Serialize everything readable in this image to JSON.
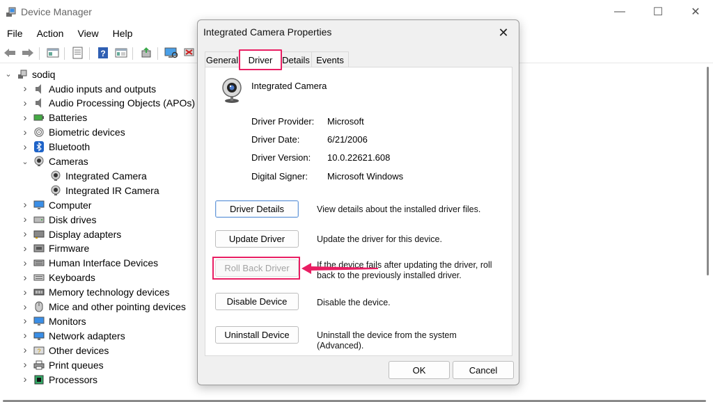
{
  "app": {
    "title": "Device Manager"
  },
  "window_controls": {
    "minimize": "—",
    "maximize": "☐",
    "close": "✕"
  },
  "menu": [
    "File",
    "Action",
    "View",
    "Help"
  ],
  "toolbar": {
    "icons": [
      "back-icon",
      "forward-icon",
      "properties-icon",
      "refresh-icon",
      "help-icon",
      "show-hidden-icon",
      "update-driver-icon",
      "scan-hardware-icon",
      "remove-device-icon"
    ]
  },
  "tree": {
    "root": "sodiq",
    "items": [
      {
        "label": "Audio inputs and outputs",
        "icon": "speaker-icon",
        "expanded": false
      },
      {
        "label": "Audio Processing Objects (APOs)",
        "icon": "speaker-icon",
        "expanded": false
      },
      {
        "label": "Batteries",
        "icon": "battery-icon",
        "expanded": false
      },
      {
        "label": "Biometric devices",
        "icon": "fingerprint-icon",
        "expanded": false
      },
      {
        "label": "Bluetooth",
        "icon": "bluetooth-icon",
        "expanded": false
      },
      {
        "label": "Cameras",
        "icon": "camera-icon",
        "expanded": true
      },
      {
        "label": "Integrated Camera",
        "icon": "camera-icon",
        "child": true
      },
      {
        "label": "Integrated IR Camera",
        "icon": "camera-icon",
        "child": true
      },
      {
        "label": "Computer",
        "icon": "monitor-icon",
        "expanded": false
      },
      {
        "label": "Disk drives",
        "icon": "disk-icon",
        "expanded": false
      },
      {
        "label": "Display adapters",
        "icon": "display-adapter-icon",
        "expanded": false
      },
      {
        "label": "Firmware",
        "icon": "firmware-icon",
        "expanded": false
      },
      {
        "label": "Human Interface Devices",
        "icon": "hid-icon",
        "expanded": false
      },
      {
        "label": "Keyboards",
        "icon": "keyboard-icon",
        "expanded": false
      },
      {
        "label": "Memory technology devices",
        "icon": "memory-icon",
        "expanded": false
      },
      {
        "label": "Mice and other pointing devices",
        "icon": "mouse-icon",
        "expanded": false
      },
      {
        "label": "Monitors",
        "icon": "monitor-icon",
        "expanded": false
      },
      {
        "label": "Network adapters",
        "icon": "network-icon",
        "expanded": false
      },
      {
        "label": "Other devices",
        "icon": "other-device-icon",
        "expanded": false
      },
      {
        "label": "Print queues",
        "icon": "printer-icon",
        "expanded": false
      },
      {
        "label": "Processors",
        "icon": "processor-icon",
        "expanded": false
      }
    ]
  },
  "dialog": {
    "title": "Integrated Camera Properties",
    "tabs": [
      "General",
      "Driver",
      "Details",
      "Events"
    ],
    "active_tab": "Driver",
    "device_name": "Integrated Camera",
    "info": [
      {
        "label": "Driver Provider:",
        "value": "Microsoft"
      },
      {
        "label": "Driver Date:",
        "value": "6/21/2006"
      },
      {
        "label": "Driver Version:",
        "value": "10.0.22621.608"
      },
      {
        "label": "Digital Signer:",
        "value": "Microsoft Windows"
      }
    ],
    "buttons": [
      {
        "label": "Driver Details",
        "desc": "View details about the installed driver files."
      },
      {
        "label": "Update Driver",
        "desc": "Update the driver for this device."
      },
      {
        "label": "Roll Back Driver",
        "desc": "If the device fails after updating the driver, roll back to the previously installed driver.",
        "disabled": true
      },
      {
        "label": "Disable Device",
        "desc": "Disable the device."
      },
      {
        "label": "Uninstall Device",
        "desc": "Uninstall the device from the system (Advanced)."
      }
    ],
    "ok": "OK",
    "cancel": "Cancel"
  },
  "colors": {
    "highlight": "#e91e63",
    "accent": "#6a9ad8"
  }
}
